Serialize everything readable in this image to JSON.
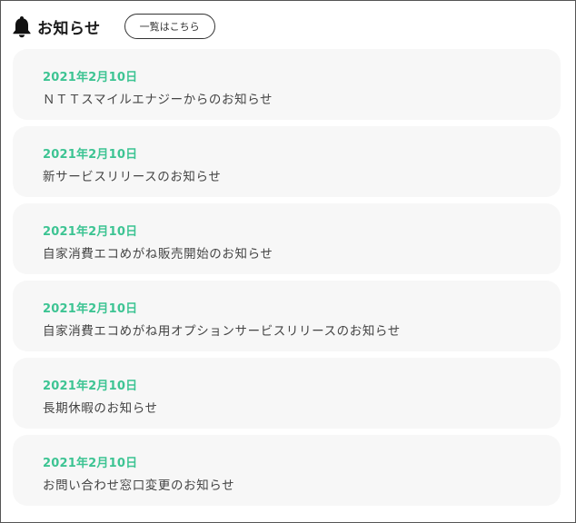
{
  "header": {
    "title": "お知らせ",
    "icon": "bell-icon",
    "list_link_label": "一覧はこちら"
  },
  "colors": {
    "date": "#3dc493",
    "card_background": "#f7f7f7"
  },
  "news": [
    {
      "date": "2021年2月10日",
      "title": "ＮＴＴスマイルエナジーからのお知らせ"
    },
    {
      "date": "2021年2月10日",
      "title": "新サービスリリースのお知らせ"
    },
    {
      "date": "2021年2月10日",
      "title": "自家消費エコめがね販売開始のお知らせ"
    },
    {
      "date": "2021年2月10日",
      "title": "自家消費エコめがね用オプションサービスリリースのお知らせ"
    },
    {
      "date": "2021年2月10日",
      "title": "長期休暇のお知らせ"
    },
    {
      "date": "2021年2月10日",
      "title": "お問い合わせ窓口変更のお知らせ"
    }
  ]
}
